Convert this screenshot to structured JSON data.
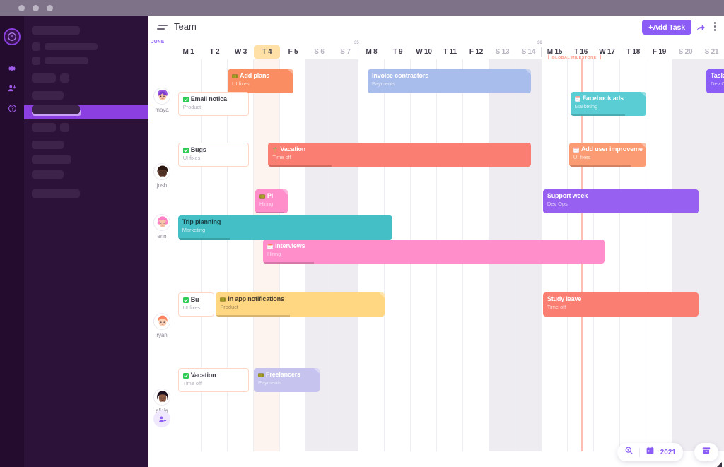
{
  "window": {
    "dots": [
      "close",
      "minimize",
      "maximize"
    ]
  },
  "sidebar": {
    "rail_icons": [
      "clock-logo-icon",
      "gear-icon",
      "add-user-icon",
      "help-icon"
    ],
    "placeholder_count": 11
  },
  "topbar": {
    "menu_icon": "filter-icon",
    "title": "Team",
    "add_task_label": "+Add Task",
    "share_icon": "share-icon",
    "more_icon": "more-vertical-icon"
  },
  "timeline": {
    "month_label": "JUNE",
    "today_index": 3,
    "days": [
      {
        "label": "M 1",
        "weekend": false
      },
      {
        "label": "T 2",
        "weekend": false
      },
      {
        "label": "W 3",
        "weekend": false
      },
      {
        "label": "T 4",
        "weekend": false
      },
      {
        "label": "F 5",
        "weekend": false
      },
      {
        "label": "S 6",
        "weekend": true
      },
      {
        "label": "S 7",
        "weekend": true
      },
      {
        "label": "M 8",
        "weekend": false
      },
      {
        "label": "T 9",
        "weekend": false
      },
      {
        "label": "W 10",
        "weekend": false
      },
      {
        "label": "T 11",
        "weekend": false
      },
      {
        "label": "F 12",
        "weekend": false
      },
      {
        "label": "S 13",
        "weekend": true
      },
      {
        "label": "S 14",
        "weekend": true
      },
      {
        "label": "M 15",
        "weekend": false
      },
      {
        "label": "T 16",
        "weekend": false
      },
      {
        "label": "W 17",
        "weekend": false
      },
      {
        "label": "T 18",
        "weekend": false
      },
      {
        "label": "F 19",
        "weekend": false
      },
      {
        "label": "S 20",
        "weekend": true
      },
      {
        "label": "S 21",
        "weekend": true
      }
    ],
    "week_markers": [
      {
        "label": "35",
        "after_day": 7
      },
      {
        "label": "36",
        "after_day": 14
      }
    ],
    "milestone": {
      "label": "GLOBAL MILESTONE",
      "day_index": 15,
      "color": "#ffb3a7"
    }
  },
  "people": [
    {
      "name": "maya",
      "avatar": "avatar-maya"
    },
    {
      "name": "josh",
      "avatar": "avatar-josh"
    },
    {
      "name": "erin",
      "avatar": "avatar-erin"
    },
    {
      "name": "ryan",
      "avatar": "avatar-ryan"
    },
    {
      "name": "alicia",
      "avatar": "avatar-alicia"
    }
  ],
  "add_person_icon": "add-person-icon",
  "tasks": [
    {
      "title": "Add plans",
      "subtitle": "UI fixes",
      "icon": "ruler-icon",
      "bg": "#fa8e62",
      "fg": "#ffffff",
      "sub_fg": "#ffe0cf",
      "row": 0,
      "lane": 0,
      "start": 2,
      "end": 4.5,
      "progress": 0,
      "corner": true
    },
    {
      "title": "Invoice contractors",
      "subtitle": "Payments",
      "icon": "none",
      "bg": "#a8bdec",
      "fg": "#ffffff",
      "sub_fg": "#e6ecfa",
      "row": 0,
      "lane": 0,
      "start": 7.35,
      "end": 13.6,
      "progress": 0,
      "corner": true
    },
    {
      "title": "Email notica",
      "subtitle": "Product",
      "icon": "check-icon",
      "bg": "#ffffff",
      "fg": "#43404a",
      "sub_fg": "#b4b0bb",
      "row": 0,
      "lane": 1,
      "start": 0.1,
      "end": 2.8,
      "progress": 0,
      "corner": true,
      "border": "#ffd7c8"
    },
    {
      "title": "Facebook ads",
      "subtitle": "Marketing",
      "icon": "note-icon",
      "bg": "#59cdd3",
      "fg": "#ffffff",
      "sub_fg": "#dff6f7",
      "row": 0,
      "lane": 2,
      "start": 15.1,
      "end": 18.0,
      "progress": 72,
      "corner": true
    },
    {
      "title": "Task n",
      "subtitle": "Dev Op",
      "icon": "none",
      "bg": "#8b5cf6",
      "fg": "#ffffff",
      "sub_fg": "#d9c9fd",
      "row": 0,
      "lane": 0,
      "start": 20.3,
      "end": 22.5,
      "progress": 0,
      "corner": false
    },
    {
      "title": "Bugs",
      "subtitle": "UI fixes",
      "icon": "check-icon",
      "bg": "#ffffff",
      "fg": "#43404a",
      "sub_fg": "#b4b0bb",
      "row": 1,
      "lane": 0,
      "start": 0.1,
      "end": 2.8,
      "progress": 0,
      "corner": true,
      "border": "#ffd7c8"
    },
    {
      "title": "Vacation",
      "subtitle": "Time off",
      "icon": "palm-icon",
      "bg": "#fa7f72",
      "fg": "#ffffff",
      "sub_fg": "#ffdcd6",
      "row": 1,
      "lane": 0,
      "start": 3.55,
      "end": 13.6,
      "progress": 24,
      "corner": false
    },
    {
      "title": "Add user improveme",
      "subtitle": "UI fixes",
      "icon": "note-icon",
      "bg": "#fa9b73",
      "fg": "#ffffff",
      "sub_fg": "#ffe3d4",
      "row": 1,
      "lane": 0,
      "start": 15.05,
      "end": 18.0,
      "progress": 80,
      "corner": true
    },
    {
      "title": "Pl",
      "subtitle": "Hiring",
      "icon": "ruler-icon",
      "bg": "#ff8ecb",
      "fg": "#ffffff",
      "sub_fg": "#ffd9ee",
      "row": 2,
      "lane": 0,
      "start": 3.05,
      "end": 4.3,
      "progress": 90,
      "corner": true
    },
    {
      "title": "Support week",
      "subtitle": "Dev Ops",
      "icon": "none",
      "bg": "#9760f0",
      "fg": "#ffffff",
      "sub_fg": "#ddcbfb",
      "row": 2,
      "lane": 0,
      "start": 14.05,
      "end": 20.0,
      "progress": 0,
      "corner": false
    },
    {
      "title": "Trip planning",
      "subtitle": "Marketing",
      "icon": "none",
      "bg": "#44bfc6",
      "fg": "#153f44",
      "sub_fg": "#cdeef0",
      "row": 2,
      "lane": 1,
      "start": 0.1,
      "end": 8.3,
      "progress": 24,
      "corner": false
    },
    {
      "title": "Interviews",
      "subtitle": "Hiring",
      "icon": "note-icon",
      "bg": "#ff8ecb",
      "fg": "#ffffff",
      "sub_fg": "#ffd9ee",
      "row": 2,
      "lane": 2,
      "start": 3.35,
      "end": 16.4,
      "progress": 15,
      "corner": false
    },
    {
      "title": "Bu",
      "subtitle": "UI fixes",
      "icon": "check-icon",
      "bg": "#ffffff",
      "fg": "#43404a",
      "sub_fg": "#b4b0bb",
      "row": 3,
      "lane": 0,
      "start": 0.1,
      "end": 1.5,
      "progress": 0,
      "corner": true,
      "border": "#ffd7c8"
    },
    {
      "title": "In app notifications",
      "subtitle": "Product",
      "icon": "ruler-icon",
      "bg": "#ffd782",
      "fg": "#4a4030",
      "sub_fg": "#a08a55",
      "row": 3,
      "lane": 0,
      "start": 1.55,
      "end": 8.0,
      "progress": 44,
      "corner": true
    },
    {
      "title": "Study leave",
      "subtitle": "Time off",
      "icon": "none",
      "bg": "#fa7f72",
      "fg": "#ffffff",
      "sub_fg": "#ffdcd6",
      "row": 3,
      "lane": 0,
      "start": 14.05,
      "end": 20.0,
      "progress": 0,
      "corner": false
    },
    {
      "title": "Vacation",
      "subtitle": "Time off",
      "icon": "check-icon",
      "bg": "#ffffff",
      "fg": "#43404a",
      "sub_fg": "#b4b0bb",
      "row": 4,
      "lane": 0,
      "start": 0.1,
      "end": 2.8,
      "progress": 0,
      "corner": true,
      "border": "#ffd7c8"
    },
    {
      "title": "Freelancers",
      "subtitle": "Payments",
      "icon": "ruler-icon",
      "bg": "#c6c4ef",
      "fg": "#ffffff",
      "sub_fg": "#ebeafa",
      "row": 4,
      "lane": 0,
      "start": 3.0,
      "end": 5.5,
      "progress": 0,
      "corner": true
    }
  ],
  "footer": {
    "search_icon": "zoom-search-icon",
    "calendar_icon": "calendar-icon",
    "year": "2021",
    "archive_icon": "archive-icon"
  }
}
